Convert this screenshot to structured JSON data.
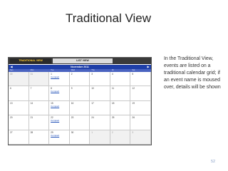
{
  "slide": {
    "title": "Traditional View",
    "description": "In the Traditional View, events are listed on a traditional calendar grid; if an event name is moused over, details will be shown",
    "page_number": "52"
  },
  "calendar": {
    "tabs": [
      {
        "label": "TRADITIONAL VIEW",
        "active": true
      },
      {
        "label": "LIST VIEW",
        "active": false
      }
    ],
    "month_label": "November 2011",
    "prev_icon": "arrow-left-icon",
    "next_icon": "arrow-right-icon",
    "weekdays": [
      "Sun",
      "Mon",
      "Tue",
      "Wed",
      "Thu",
      "Fri",
      "Sat"
    ],
    "weeks": [
      [
        {
          "day": "30",
          "other": true
        },
        {
          "day": "31",
          "other": true
        },
        {
          "day": "1",
          "event": "Compact"
        },
        {
          "day": "2"
        },
        {
          "day": "3"
        },
        {
          "day": "4"
        },
        {
          "day": "5"
        }
      ],
      [
        {
          "day": "6"
        },
        {
          "day": "7"
        },
        {
          "day": "8",
          "event": "Compact"
        },
        {
          "day": "9"
        },
        {
          "day": "10"
        },
        {
          "day": "11"
        },
        {
          "day": "12"
        }
      ],
      [
        {
          "day": "13"
        },
        {
          "day": "14"
        },
        {
          "day": "15",
          "event": "Compact"
        },
        {
          "day": "16"
        },
        {
          "day": "17"
        },
        {
          "day": "18"
        },
        {
          "day": "19"
        }
      ],
      [
        {
          "day": "20"
        },
        {
          "day": "21"
        },
        {
          "day": "22",
          "event": "Compact"
        },
        {
          "day": "23"
        },
        {
          "day": "24"
        },
        {
          "day": "25"
        },
        {
          "day": "26"
        }
      ],
      [
        {
          "day": "27"
        },
        {
          "day": "28"
        },
        {
          "day": "29",
          "event": "Compact"
        },
        {
          "day": "30"
        },
        {
          "day": "1",
          "other": true
        },
        {
          "day": "2",
          "other": true
        },
        {
          "day": "3",
          "other": true
        }
      ]
    ]
  }
}
